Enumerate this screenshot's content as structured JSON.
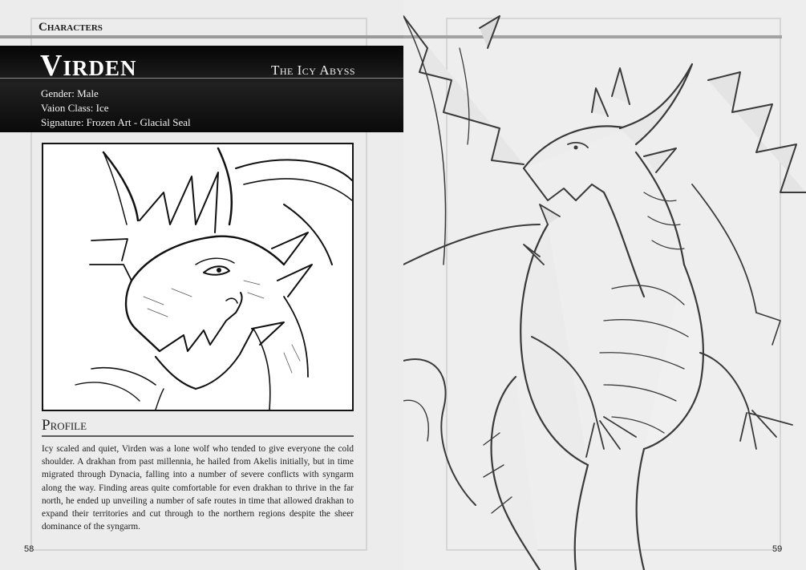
{
  "left_page": {
    "section": "Characters",
    "character": {
      "name": "Virden",
      "title": "The Icy Abyss",
      "stats": [
        "Gender: Male",
        "Vaion Class: Ice",
        "Signature: Frozen Art - Glacial Seal"
      ]
    },
    "profile": {
      "heading": "Profile",
      "text": "Icy scaled and quiet, Virden was a lone wolf who tended to give everyone the cold shoulder. A drakhan from past millennia, he hailed from Akelis initially, but in time migrated through Dynacia, falling into a number of severe conflicts with syngarm along the way. Finding areas quite comfortable for even drakhan to thrive in the far north, he ended up unveiling a number of safe routes in time that allowed drakhan to expand their territories and cut through to the northern regions despite the sheer dominance of the syngarm."
    },
    "page_number": "58"
  },
  "right_page": {
    "page_number": "59"
  }
}
